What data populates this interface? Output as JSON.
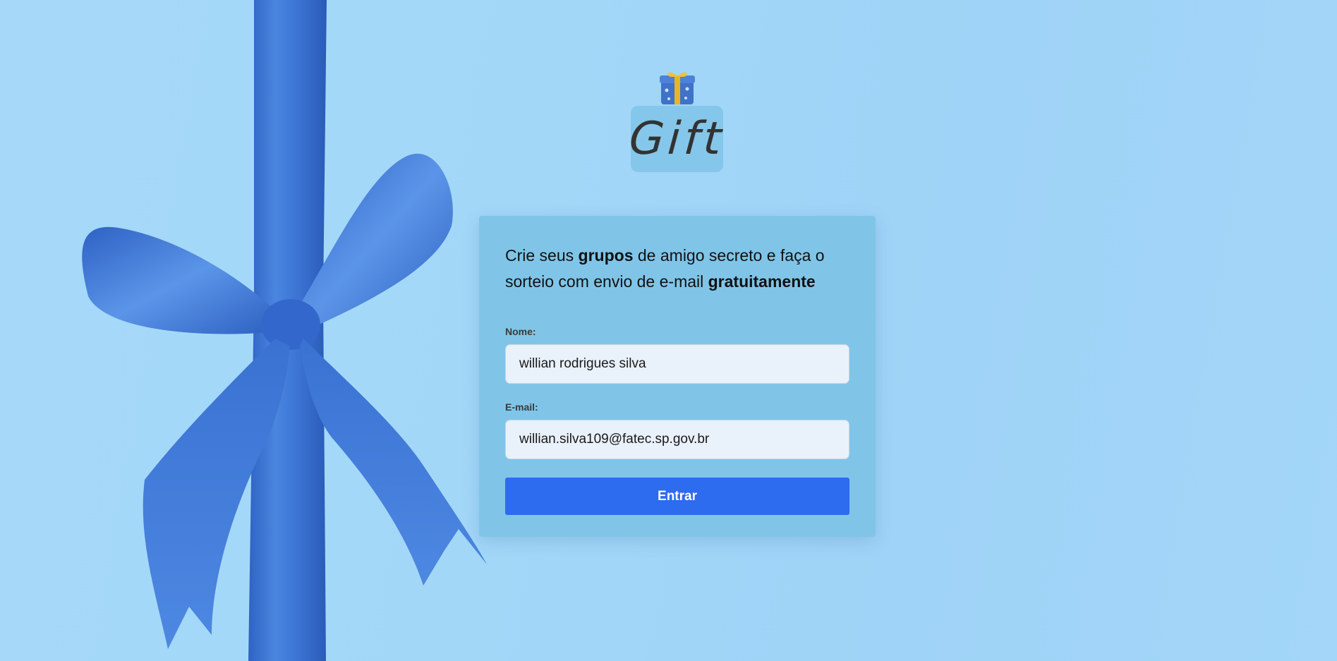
{
  "app": {
    "logo_text": "Gift",
    "logo_icon": "gift-box-icon",
    "colors": {
      "background": "#a2d7f8",
      "card": "#80c5e8",
      "primary_button": "#2d6bef",
      "ribbon": "#3e78d6"
    }
  },
  "login": {
    "intro_part1": "Crie seus ",
    "intro_bold1": "grupos",
    "intro_part2": " de amigo secreto e faça o sorteio com envio de e-mail ",
    "intro_bold2": "gratuitamente",
    "name_label": "Nome:",
    "name_value": "willian rodrigues silva",
    "email_label": "E-mail:",
    "email_value": "willian.silva109@fatec.sp.gov.br",
    "submit_label": "Entrar"
  }
}
